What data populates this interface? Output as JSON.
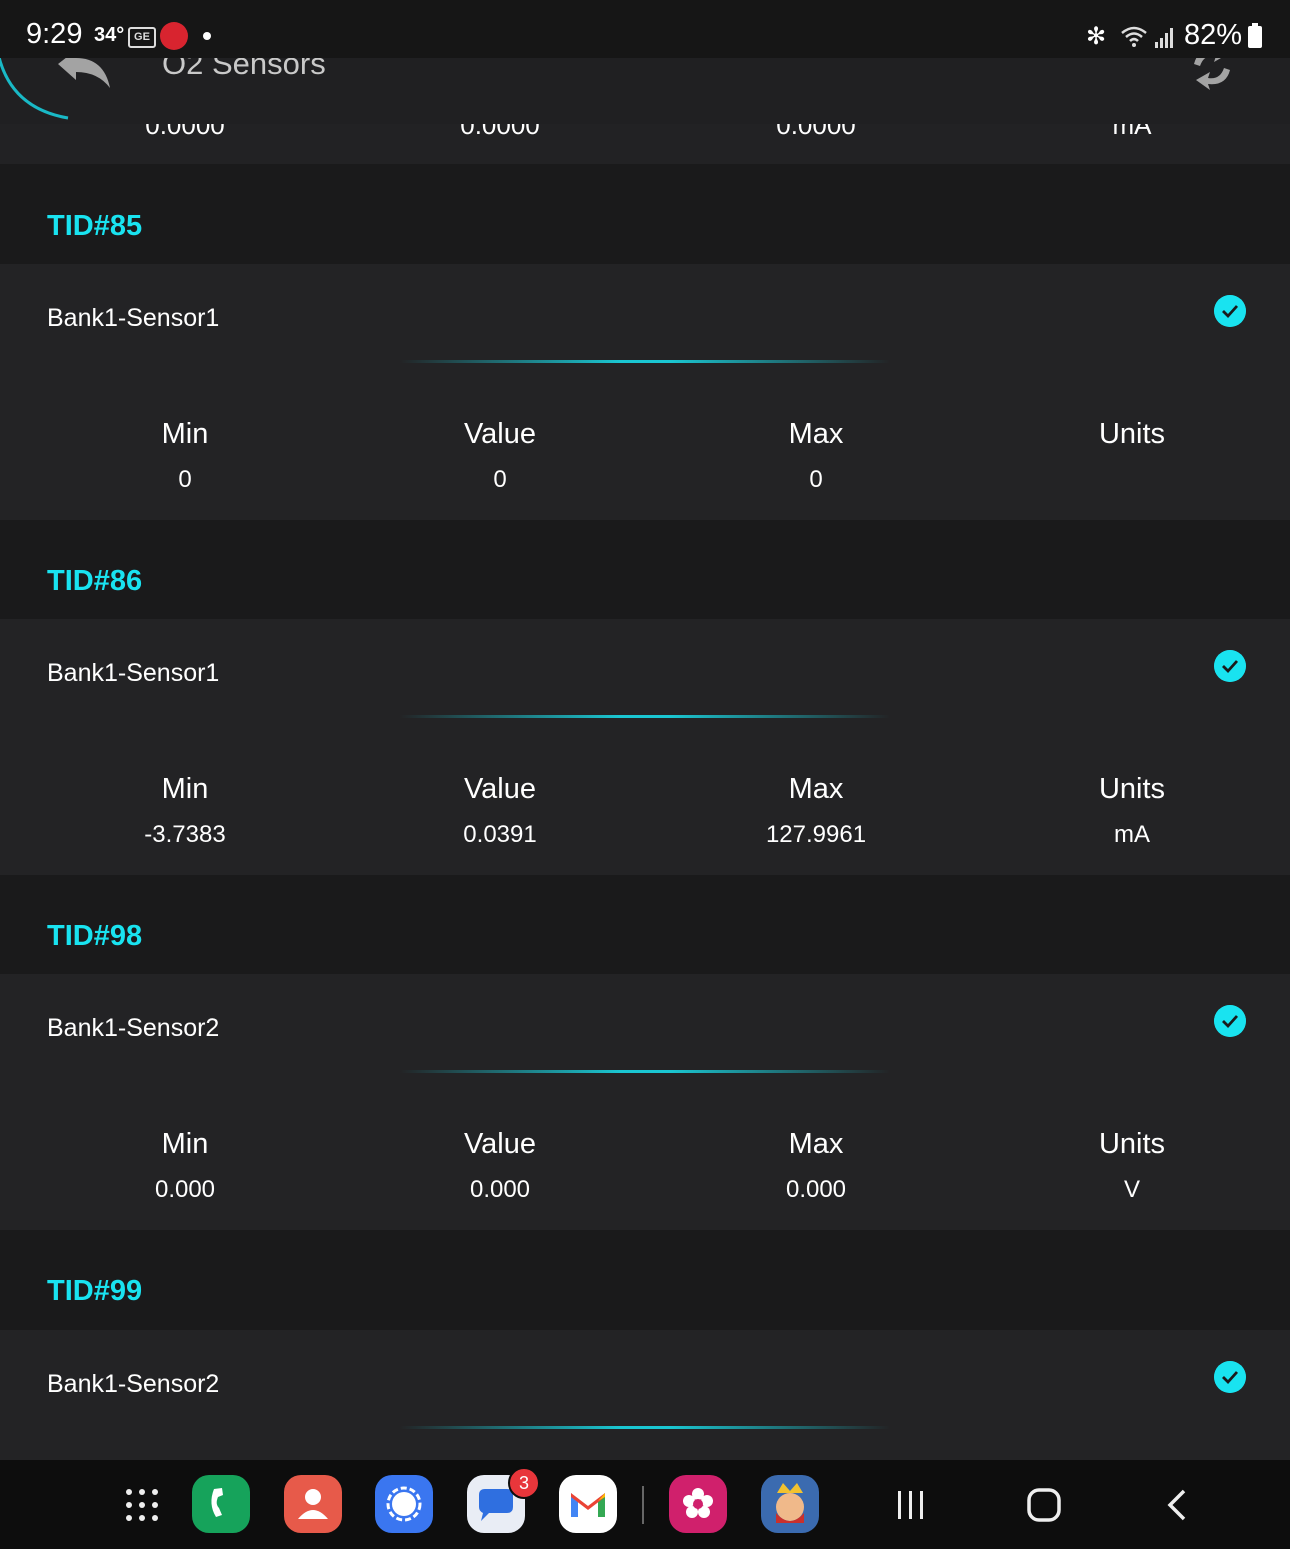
{
  "status_bar": {
    "time": "9:29",
    "temperature": "34°",
    "ge_label": "GE",
    "battery": "82%"
  },
  "header": {
    "title": "O2 Sensors"
  },
  "previous_card": {
    "min": "0.0000",
    "value": "0.0000",
    "max": "0.0000",
    "units": "mA"
  },
  "columns": {
    "min": "Min",
    "value": "Value",
    "max": "Max",
    "units": "Units"
  },
  "sections": [
    {
      "tid": "TID#85",
      "sensor": "Bank1-Sensor1",
      "min": "0",
      "value": "0",
      "max": "0",
      "units": ""
    },
    {
      "tid": "TID#86",
      "sensor": "Bank1-Sensor1",
      "min": "-3.7383",
      "value": "0.0391",
      "max": "127.9961",
      "units": "mA"
    },
    {
      "tid": "TID#98",
      "sensor": "Bank1-Sensor2",
      "min": "0.000",
      "value": "0.000",
      "max": "0.000",
      "units": "V"
    },
    {
      "tid": "TID#99",
      "sensor": "Bank1-Sensor2"
    }
  ],
  "nav": {
    "messages_badge": "3"
  },
  "colors": {
    "accent": "#19e3f0",
    "background": "#1a1a1b",
    "card": "#232325"
  }
}
